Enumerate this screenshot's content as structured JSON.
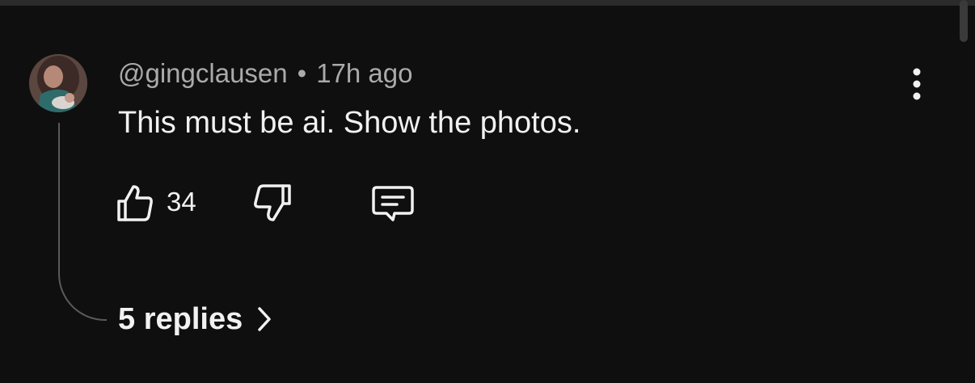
{
  "comment": {
    "author_handle": "@gingclausen",
    "separator": "•",
    "timestamp": "17h ago",
    "text": "This must be ai. Show the photos.",
    "like_count": "34"
  },
  "replies": {
    "label": "5 replies"
  },
  "icons": {
    "menu": "vertical-ellipsis-icon",
    "like": "thumbs-up-icon",
    "dislike": "thumbs-down-icon",
    "reply": "comment-bubble-icon",
    "replies_chevron": "chevron-right-icon"
  },
  "colors": {
    "background": "#0f0f0f",
    "primary_text": "#f1f1f1",
    "secondary_text": "#aaaaaa",
    "thread_line": "#5a5a5a"
  }
}
